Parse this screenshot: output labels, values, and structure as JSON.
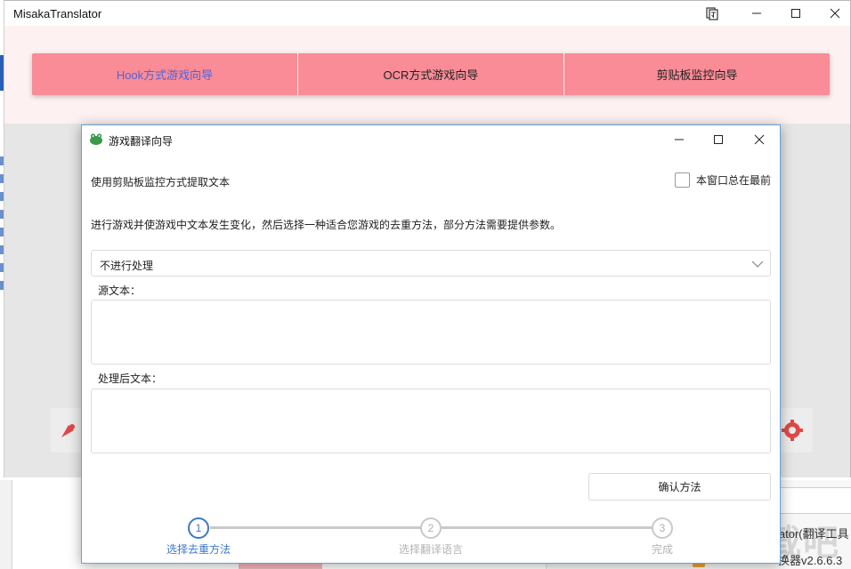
{
  "app": {
    "title": "MisakaTranslator",
    "tabs": [
      {
        "label": "Hook方式游戏向导",
        "active": true
      },
      {
        "label": "OCR方式游戏向导",
        "active": false
      },
      {
        "label": "剪贴板监控向导",
        "active": false
      }
    ]
  },
  "background": {
    "text_a": "lator(翻译工具",
    "text_b": "换器v2.6.6.3",
    "watermark": "下载吧"
  },
  "dialog": {
    "title": "游戏翻译向导",
    "heading": "使用剪贴板监控方式提取文本",
    "topmost_label": "本窗口总在最前",
    "description": "进行游戏并使游戏中文本发生变化，然后选择一种适合您游戏的去重方法，部分方法需要提供参数。",
    "method_select": {
      "value": "不进行处理"
    },
    "source_label": "源文本：",
    "processed_label": "处理后文本：",
    "confirm_label": "确认方法",
    "steps": [
      {
        "number": "1",
        "label": "选择去重方法",
        "active": true
      },
      {
        "number": "2",
        "label": "选择翻译语言",
        "active": false
      },
      {
        "number": "3",
        "label": "完成",
        "active": false
      }
    ]
  },
  "colors": {
    "tab_bar": "#f98c97",
    "tab_active_text": "#5561d6",
    "step_active": "#3c78c8",
    "dialog_border": "#6aa1d8"
  }
}
